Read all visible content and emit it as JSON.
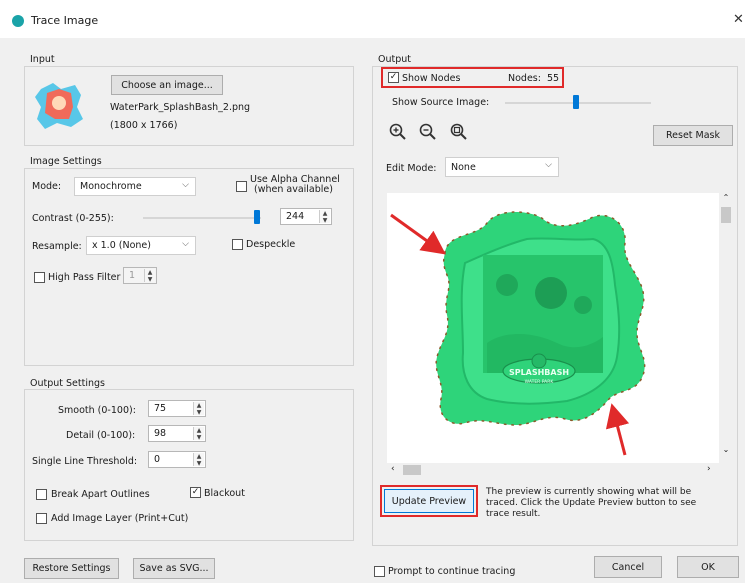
{
  "window": {
    "title": "Trace Image"
  },
  "input": {
    "group_label": "Input",
    "choose_label": "Choose an image...",
    "file_name": "WaterPark_SplashBash_2.png",
    "dimensions": "(1800 x 1766)"
  },
  "image_settings": {
    "group_label": "Image Settings",
    "mode_label": "Mode:",
    "mode_value": "Monochrome",
    "alpha_label_1": "Use Alpha Channel",
    "alpha_label_2": "(when available)",
    "contrast_label": "Contrast (0-255):",
    "contrast_value": "244",
    "resample_label": "Resample:",
    "resample_value": "x 1.0 (None)",
    "despeckle_label": "Despeckle",
    "highpass_label": "High Pass Filter",
    "highpass_value": "1"
  },
  "output_settings": {
    "group_label": "Output Settings",
    "smooth_label": "Smooth (0-100):",
    "smooth_value": "75",
    "detail_label": "Detail (0-100):",
    "detail_value": "98",
    "single_line_label": "Single Line Threshold:",
    "single_line_value": "0",
    "break_apart_label": "Break Apart Outlines",
    "blackout_label": "Blackout",
    "add_layer_label": "Add Image Layer (Print+Cut)"
  },
  "output": {
    "group_label": "Output",
    "show_nodes_label": "Show Nodes",
    "nodes_label": "Nodes:",
    "nodes_count": "55",
    "show_source_label": "Show Source Image:",
    "reset_mask_label": "Reset Mask",
    "edit_mode_label": "Edit Mode:",
    "edit_mode_value": "None",
    "logo_text_1": "SPLASHBASH",
    "logo_text_2": "WATER PARK",
    "update_preview_label": "Update Preview",
    "preview_note": "The preview is currently showing what will be traced. Click the Update Preview button to see trace result."
  },
  "footer": {
    "restore_label": "Restore Settings",
    "save_svg_label": "Save as SVG...",
    "prompt_label": "Prompt to continue tracing",
    "cancel_label": "Cancel",
    "ok_label": "OK"
  },
  "icons": {
    "zoom_in": "zoom-in-icon",
    "zoom_out": "zoom-out-icon",
    "zoom_fit": "zoom-fit-icon"
  },
  "colors": {
    "accent": "#0078d7",
    "highlight": "#e02a2a",
    "trace_fill": "#2ed47a"
  },
  "sliders": {
    "contrast_fraction": 0.96,
    "show_source_fraction": 0.5
  },
  "checkboxes": {
    "show_nodes": true,
    "use_alpha": false,
    "despeckle": false,
    "high_pass": false,
    "break_apart": false,
    "blackout": true,
    "add_image_layer": false,
    "prompt_continue": false
  }
}
